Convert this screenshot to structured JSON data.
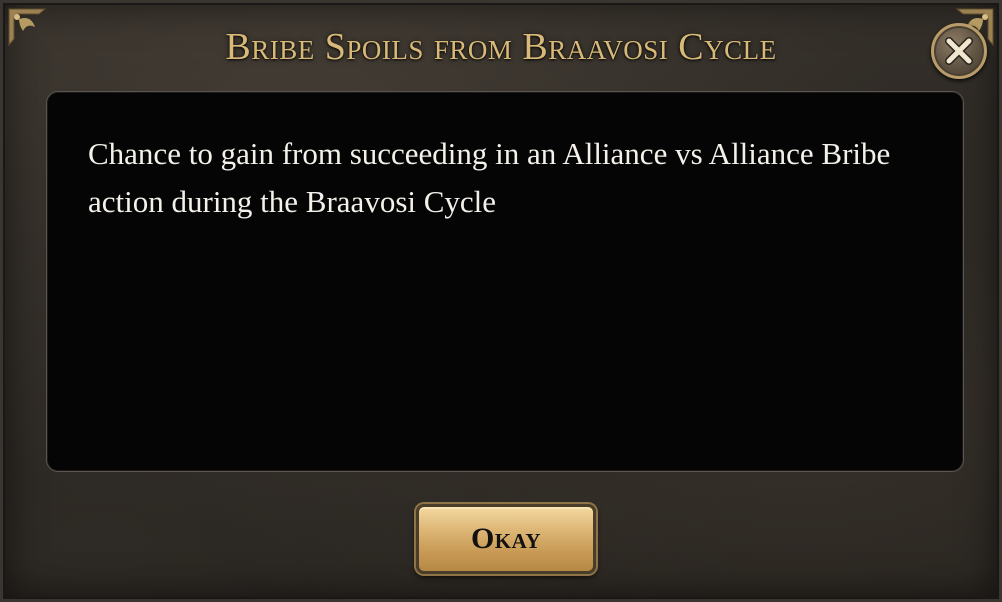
{
  "dialog": {
    "title": "Bribe Spoils from Braavosi Cycle",
    "description": "Chance to gain from succeeding in an Alliance vs Alliance Bribe action during the Braavosi Cycle",
    "close_icon": "close-x-icon",
    "okay_label": "Okay"
  },
  "colors": {
    "title_gold": "#d9b978",
    "panel_black": "#050505",
    "button_gold": "#deb777"
  }
}
